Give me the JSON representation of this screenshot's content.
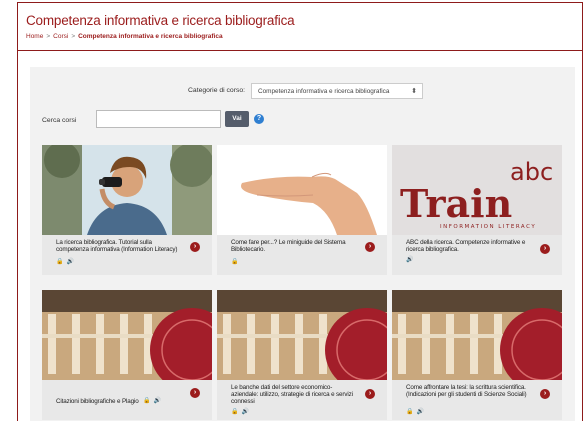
{
  "header": {
    "title": "Competenza informativa e ricerca bibliografica",
    "breadcrumb": [
      "Home",
      "Corsi",
      "Competenza informativa e ricerca bibliografica"
    ],
    "breadcrumb_sep": ">"
  },
  "filters": {
    "category_label": "Categorie di corso:",
    "category_selected": "Competenza informativa e ricerca bibliografica",
    "search_label": "Cerca corsi",
    "search_value": "",
    "search_button": "Vai",
    "help_glyph": "?"
  },
  "courses": [
    {
      "title": "La ricerca bibliografica. Tutorial sulla competenza informativa (Information Literacy)",
      "icons": [
        "lock-icon",
        "speaker-icon"
      ]
    },
    {
      "title": "Come fare per...? Le miniguide del Sistema Bibliotecario.",
      "icons": [
        "lock-icon"
      ]
    },
    {
      "title": "ABC della ricerca. Competenze informative e ricerca bibliografica.",
      "icons": [
        "speaker-icon"
      ]
    },
    {
      "title": "Citazioni bibliografiche e Plagio",
      "icons": [
        "lock-icon",
        "speaker-icon"
      ]
    },
    {
      "title": "Le banche dati del settore economico-aziendale: utilizzo, strategie di ricerca e servizi connessi",
      "icons": [
        "lock-icon",
        "speaker-icon"
      ]
    },
    {
      "title": "Come affrontare la tesi: la scrittura scientifica. (Indicazioni per gli studenti di Scienze Sociali)",
      "icons": [
        "lock-icon",
        "speaker-icon"
      ]
    }
  ],
  "train_logo": {
    "abc": "abc",
    "word": "Train",
    "caption": "INFORMATION LITERACY"
  },
  "colors": {
    "accent": "#9b1c1c",
    "button": "#555d6b",
    "help": "#2f7fd1"
  }
}
